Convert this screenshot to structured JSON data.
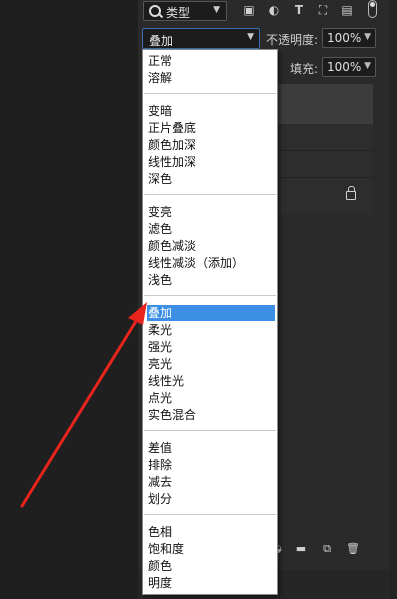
{
  "layers_panel": {
    "filter": {
      "label": "类型"
    },
    "filter_icons": [
      "image-filter-icon",
      "adjustment-filter-icon",
      "type-filter-icon",
      "shape-filter-icon",
      "smart-object-filter-icon"
    ],
    "blend_mode": {
      "value": "叠加"
    },
    "opacity": {
      "label": "不透明度:",
      "value": "100%"
    },
    "fill": {
      "label": "填充:",
      "value": "100%"
    },
    "bottom_icons": [
      "adjustment-layer-icon",
      "new-group-icon",
      "new-layer-icon",
      "delete-icon"
    ]
  },
  "blend_menu": {
    "groups": [
      [
        "正常",
        "溶解"
      ],
      [
        "变暗",
        "正片叠底",
        "颜色加深",
        "线性加深",
        "深色"
      ],
      [
        "变亮",
        "滤色",
        "颜色减淡",
        "线性减淡（添加）",
        "浅色"
      ],
      [
        "叠加",
        "柔光",
        "强光",
        "亮光",
        "线性光",
        "点光",
        "实色混合"
      ],
      [
        "差值",
        "排除",
        "减去",
        "划分"
      ],
      [
        "色相",
        "饱和度",
        "颜色",
        "明度"
      ]
    ],
    "selected": "叠加"
  },
  "annotation": {
    "arrow_color": "#e8241c"
  },
  "colors": {
    "highlight": "#3d8fe6",
    "panel": "#2a2a2a"
  }
}
